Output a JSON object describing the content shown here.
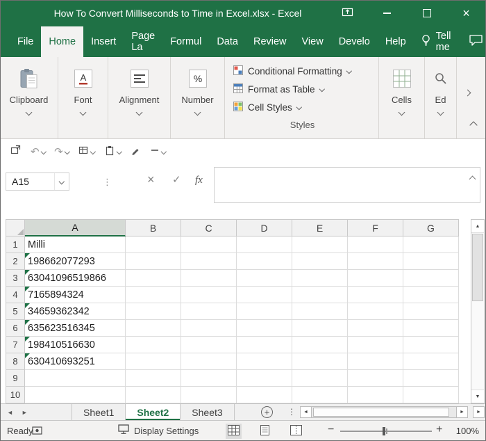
{
  "window": {
    "title": "How To Convert Milliseconds to Time in Excel.xlsx - Excel"
  },
  "ribbon_tabs": {
    "items": [
      {
        "label": "File"
      },
      {
        "label": "Home",
        "active": true
      },
      {
        "label": "Insert"
      },
      {
        "label": "Page La"
      },
      {
        "label": "Formul"
      },
      {
        "label": "Data"
      },
      {
        "label": "Review"
      },
      {
        "label": "View"
      },
      {
        "label": "Develo"
      },
      {
        "label": "Help"
      }
    ],
    "tell_me_label": "Tell me"
  },
  "ribbon": {
    "collapsed_groups": [
      {
        "label": "Clipboard"
      },
      {
        "label": "Font"
      },
      {
        "label": "Alignment"
      },
      {
        "label": "Number"
      }
    ],
    "styles_group": {
      "label": "Styles",
      "buttons": [
        "Conditional Formatting",
        "Format as Table",
        "Cell Styles"
      ]
    },
    "cells_group": {
      "label": "Cells"
    },
    "editing_group": {
      "label": "Ed"
    }
  },
  "formula_bar": {
    "name_box_value": "A15",
    "fx_label": "fx",
    "formula_value": ""
  },
  "grid": {
    "column_headers": [
      "A",
      "B",
      "C",
      "D",
      "E",
      "F",
      "G"
    ],
    "selected_column": "A",
    "rows": [
      {
        "num": "1",
        "value": "Milli",
        "error_flag": false
      },
      {
        "num": "2",
        "value": "198662077293",
        "error_flag": true
      },
      {
        "num": "3",
        "value": "63041096519866",
        "error_flag": true
      },
      {
        "num": "4",
        "value": "7165894324",
        "error_flag": true
      },
      {
        "num": "5",
        "value": "34659362342",
        "error_flag": true
      },
      {
        "num": "6",
        "value": "635623516345",
        "error_flag": true
      },
      {
        "num": "7",
        "value": "198410516630",
        "error_flag": true
      },
      {
        "num": "8",
        "value": "630410693251",
        "error_flag": true
      },
      {
        "num": "9",
        "value": "",
        "error_flag": false
      },
      {
        "num": "10",
        "value": "",
        "error_flag": false
      }
    ]
  },
  "sheet_tabs": {
    "tabs": [
      {
        "label": "Sheet1"
      },
      {
        "label": "Sheet2",
        "active": true
      },
      {
        "label": "Sheet3"
      }
    ]
  },
  "status_bar": {
    "mode": "Ready",
    "display_settings_label": "Display Settings",
    "zoom_level": "100%"
  },
  "icons": {
    "undo": "↶",
    "redo": "↷",
    "close": "×",
    "cancel": "×",
    "check": "✓",
    "dots": "⋮",
    "up": "▲",
    "down": "▼",
    "left": "◄",
    "right": "►",
    "plus": "+",
    "minus": "−",
    "add_sheet": "+"
  },
  "colors": {
    "excel_green": "#1f7145",
    "error_indicator_green": "#1e7145"
  }
}
